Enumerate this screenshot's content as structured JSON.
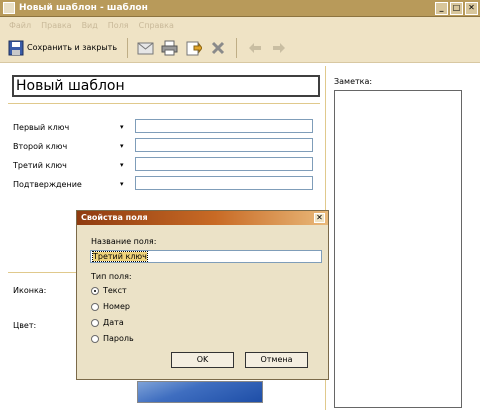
{
  "window": {
    "title": "Новый шаблон - шаблон"
  },
  "menu": [
    "Файл",
    "Правка",
    "Вид",
    "Поля",
    "Справка"
  ],
  "toolbar": {
    "save_label": "Сохранить и закрыть"
  },
  "form": {
    "name_value": "Новый шаблон",
    "fields": [
      "Первый ключ",
      "Второй ключ",
      "Третий ключ",
      "Подтверждение"
    ],
    "icon_label": "Иконка:",
    "color_label": "Цвет:",
    "note_label": "Заметка:"
  },
  "dialog": {
    "title": "Свойства поля",
    "name_label": "Название поля:",
    "name_value": "Третий ключ",
    "type_label": "Тип поля:",
    "types": [
      "Текст",
      "Номер",
      "Дата",
      "Пароль"
    ],
    "selected_type": "Текст",
    "ok": "OK",
    "cancel": "Отмена"
  },
  "colors": {
    "titlebar": "#b89a5a",
    "toolbar": "#efe3c5",
    "accent_line": "#e0c98c",
    "dialog_title": "#c86a25"
  }
}
